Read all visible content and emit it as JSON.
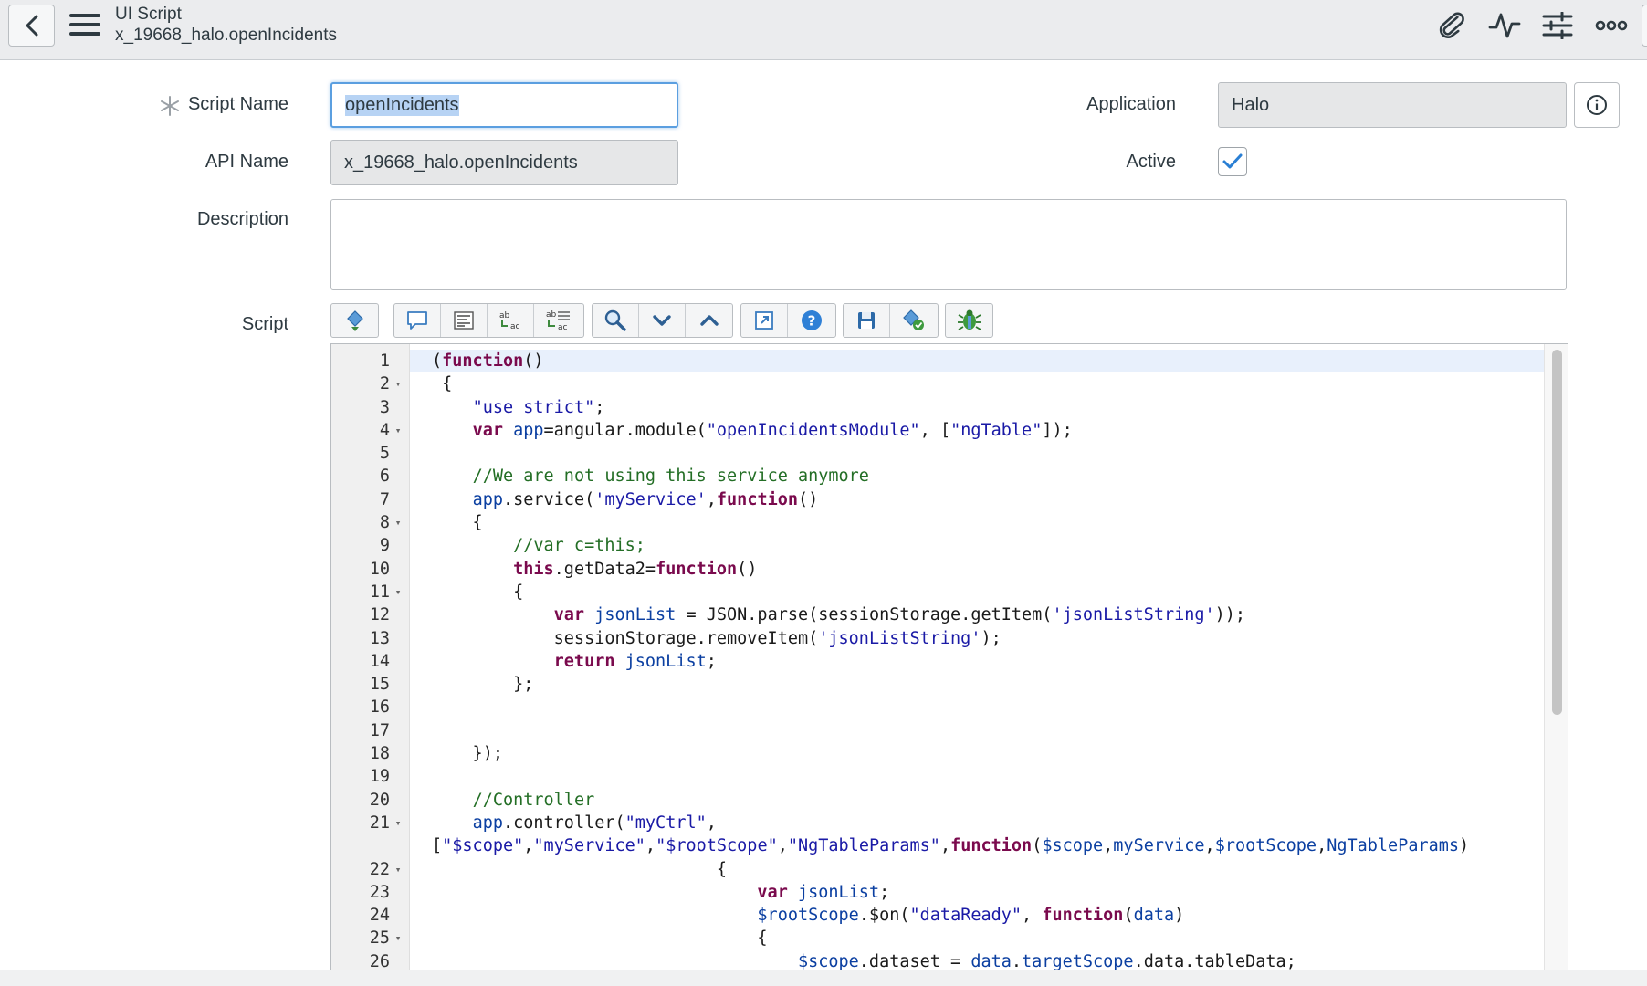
{
  "header": {
    "record_type": "UI Script",
    "record_name": "x_19668_halo.openIncidents"
  },
  "form": {
    "script_name_label": "Script Name",
    "script_name_value": "openIncidents",
    "api_name_label": "API Name",
    "api_name_value": "x_19668_halo.openIncidents",
    "description_label": "Description",
    "description_value": "",
    "script_label": "Script",
    "application_label": "Application",
    "application_value": "Halo",
    "active_label": "Active",
    "active_checked": true
  },
  "toolbar_icons": [
    "format-code-icon",
    "comment-icon",
    "format-text-icon",
    "replace-icon",
    "replace-all-icon",
    "search-icon",
    "find-next-icon",
    "find-previous-icon",
    "fullscreen-icon",
    "help-icon",
    "save-icon",
    "syntax-check-icon",
    "debug-icon"
  ],
  "code_lines": [
    {
      "n": "1",
      "fold": false,
      "active": true,
      "tokens": [
        [
          "p",
          "("
        ],
        [
          "kw",
          "function"
        ],
        [
          "p",
          "()"
        ]
      ]
    },
    {
      "n": "2",
      "fold": true,
      "tokens": [
        [
          "p",
          " {"
        ]
      ]
    },
    {
      "n": "3",
      "fold": false,
      "tokens": [
        [
          "p",
          "    "
        ],
        [
          "str",
          "\"use strict\""
        ],
        [
          "p",
          ";"
        ]
      ]
    },
    {
      "n": "4",
      "fold": true,
      "tokens": [
        [
          "p",
          "    "
        ],
        [
          "kw",
          "var"
        ],
        [
          "p",
          " "
        ],
        [
          "var",
          "app"
        ],
        [
          "p",
          "=angular.module("
        ],
        [
          "str",
          "\"openIncidentsModule\""
        ],
        [
          "p",
          ", ["
        ],
        [
          "str",
          "\"ngTable\""
        ],
        [
          "p",
          "]);"
        ]
      ]
    },
    {
      "n": "5",
      "fold": false,
      "tokens": []
    },
    {
      "n": "6",
      "fold": false,
      "tokens": [
        [
          "p",
          "    "
        ],
        [
          "cm",
          "//We are not using this service anymore"
        ]
      ]
    },
    {
      "n": "7",
      "fold": false,
      "tokens": [
        [
          "p",
          "    "
        ],
        [
          "var",
          "app"
        ],
        [
          "p",
          ".service("
        ],
        [
          "str",
          "'myService'"
        ],
        [
          "p",
          ","
        ],
        [
          "kw",
          "function"
        ],
        [
          "p",
          "()"
        ]
      ]
    },
    {
      "n": "8",
      "fold": true,
      "tokens": [
        [
          "p",
          "    {"
        ]
      ]
    },
    {
      "n": "9",
      "fold": false,
      "tokens": [
        [
          "p",
          "        "
        ],
        [
          "cm",
          "//var c=this;"
        ]
      ]
    },
    {
      "n": "10",
      "fold": false,
      "tokens": [
        [
          "p",
          "        "
        ],
        [
          "kw",
          "this"
        ],
        [
          "p",
          ".getData2="
        ],
        [
          "kw",
          "function"
        ],
        [
          "p",
          "()"
        ]
      ]
    },
    {
      "n": "11",
      "fold": true,
      "tokens": [
        [
          "p",
          "        {"
        ]
      ]
    },
    {
      "n": "12",
      "fold": false,
      "tokens": [
        [
          "p",
          "            "
        ],
        [
          "kw",
          "var"
        ],
        [
          "p",
          " "
        ],
        [
          "var",
          "jsonList"
        ],
        [
          "p",
          " = JSON.parse(sessionStorage.getItem("
        ],
        [
          "str",
          "'jsonListString'"
        ],
        [
          "p",
          "));"
        ]
      ]
    },
    {
      "n": "13",
      "fold": false,
      "tokens": [
        [
          "p",
          "            sessionStorage.removeItem("
        ],
        [
          "str",
          "'jsonListString'"
        ],
        [
          "p",
          ");"
        ]
      ]
    },
    {
      "n": "14",
      "fold": false,
      "tokens": [
        [
          "p",
          "            "
        ],
        [
          "kw",
          "return"
        ],
        [
          "p",
          " "
        ],
        [
          "var",
          "jsonList"
        ],
        [
          "p",
          ";"
        ]
      ]
    },
    {
      "n": "15",
      "fold": false,
      "tokens": [
        [
          "p",
          "        };"
        ]
      ]
    },
    {
      "n": "16",
      "fold": false,
      "tokens": []
    },
    {
      "n": "17",
      "fold": false,
      "tokens": []
    },
    {
      "n": "18",
      "fold": false,
      "tokens": [
        [
          "p",
          "    });"
        ]
      ]
    },
    {
      "n": "19",
      "fold": false,
      "tokens": []
    },
    {
      "n": "20",
      "fold": false,
      "tokens": [
        [
          "p",
          "    "
        ],
        [
          "cm",
          "//Controller"
        ]
      ]
    },
    {
      "n": "21",
      "fold": true,
      "tokens": [
        [
          "p",
          "    "
        ],
        [
          "var",
          "app"
        ],
        [
          "p",
          ".controller("
        ],
        [
          "str",
          "\"myCtrl\""
        ],
        [
          "p",
          ","
        ]
      ]
    },
    {
      "n": "",
      "fold": false,
      "tokens": [
        [
          "p",
          "["
        ],
        [
          "str",
          "\"$scope\""
        ],
        [
          "p",
          ","
        ],
        [
          "str",
          "\"myService\""
        ],
        [
          "p",
          ","
        ],
        [
          "str",
          "\"$rootScope\""
        ],
        [
          "p",
          ","
        ],
        [
          "str",
          "\"NgTableParams\""
        ],
        [
          "p",
          ","
        ],
        [
          "kw",
          "function"
        ],
        [
          "p",
          "("
        ],
        [
          "var",
          "$scope"
        ],
        [
          "p",
          ","
        ],
        [
          "var",
          "myService"
        ],
        [
          "p",
          ","
        ],
        [
          "var",
          "$rootScope"
        ],
        [
          "p",
          ","
        ],
        [
          "var",
          "NgTableParams"
        ],
        [
          "p",
          ")"
        ]
      ]
    },
    {
      "n": "22",
      "fold": true,
      "tokens": [
        [
          "p",
          "                            {"
        ]
      ]
    },
    {
      "n": "23",
      "fold": false,
      "tokens": [
        [
          "p",
          "                                "
        ],
        [
          "kw",
          "var"
        ],
        [
          "p",
          " "
        ],
        [
          "var",
          "jsonList"
        ],
        [
          "p",
          ";"
        ]
      ]
    },
    {
      "n": "24",
      "fold": false,
      "tokens": [
        [
          "p",
          "                                "
        ],
        [
          "var",
          "$rootScope"
        ],
        [
          "p",
          ".$on("
        ],
        [
          "str",
          "\"dataReady\""
        ],
        [
          "p",
          ", "
        ],
        [
          "kw",
          "function"
        ],
        [
          "p",
          "("
        ],
        [
          "var",
          "data"
        ],
        [
          "p",
          ")"
        ]
      ]
    },
    {
      "n": "25",
      "fold": true,
      "tokens": [
        [
          "p",
          "                                {"
        ]
      ]
    },
    {
      "n": "26",
      "fold": false,
      "tokens": [
        [
          "p",
          "                                    "
        ],
        [
          "var",
          "$scope"
        ],
        [
          "p",
          ".dataset = "
        ],
        [
          "var",
          "data"
        ],
        [
          "p",
          "."
        ],
        [
          "var",
          "targetScope"
        ],
        [
          "p",
          ".data.tableData;"
        ]
      ]
    }
  ]
}
